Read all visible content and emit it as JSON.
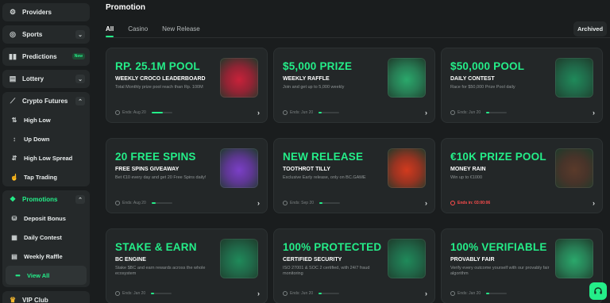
{
  "sidebar": {
    "groups": [
      {
        "items": [
          {
            "label": "Providers",
            "icon": "gear-icon"
          }
        ]
      },
      {
        "items": [
          {
            "label": "Sports",
            "icon": "ball-icon",
            "chevron": "down"
          }
        ]
      },
      {
        "items": [
          {
            "label": "Predictions",
            "icon": "bars-icon",
            "badge": "New"
          }
        ]
      },
      {
        "items": [
          {
            "label": "Lottery",
            "icon": "ticket-icon",
            "chevron": "down"
          }
        ]
      },
      {
        "items": [
          {
            "label": "Crypto Futures",
            "icon": "chart-icon",
            "chevron": "up"
          },
          {
            "label": "High Low",
            "icon": "arrows-icon"
          },
          {
            "label": "Up Down",
            "icon": "arrow-updown-icon"
          },
          {
            "label": "High Low Spread",
            "icon": "spread-icon"
          },
          {
            "label": "Tap Trading",
            "icon": "tap-icon"
          }
        ]
      },
      {
        "items": [
          {
            "label": "Promotions",
            "icon": "gift-icon",
            "chevron": "up",
            "active": true
          },
          {
            "label": "Deposit Bonus",
            "icon": "coins-icon"
          },
          {
            "label": "Daily Contest",
            "icon": "calendar-icon"
          },
          {
            "label": "Weekly Raffle",
            "icon": "ticket-icon"
          },
          {
            "label": "View All",
            "icon": "dots-icon"
          }
        ]
      },
      {
        "items": [
          {
            "label": "VIP Club",
            "icon": "crown-icon"
          }
        ]
      }
    ]
  },
  "header": {
    "title": "Promotion",
    "tabs": [
      "All",
      "Casino",
      "New Release"
    ],
    "archived": "Archived"
  },
  "cards": [
    {
      "title": "RP. 25.1M POOL",
      "subtitle": "WEEKLY CROCO LEADERBOARD",
      "desc": "Total Monthly prize pool reach than Rp. 100M",
      "foot": "Ends: Aug 20",
      "progress": 0.55,
      "art": "slot-machine-art",
      "color": "#c8223a"
    },
    {
      "title": "$5,000 PRIZE",
      "subtitle": "WEEKLY RAFFLE",
      "desc": "Join and get up to 5,000 weekly",
      "foot": "Ends: Jun 20",
      "progress": 0.15,
      "art": "raffle-machine-art",
      "color": "#2aa86b"
    },
    {
      "title": "$50,000 POOL",
      "subtitle": "DAILY CONTEST",
      "desc": "Race for $50,000 Prize Pool daily",
      "foot": "Ends: Jun 20",
      "progress": 0.15,
      "art": "trophy-art",
      "color": "#1f8a5a"
    },
    {
      "title": "20 FREE SPINS",
      "subtitle": "FREE SPINS GIVEAWAY",
      "desc": "Bet €10 every day and get 20 Free Spins daily!",
      "foot": "Ends: Aug 20",
      "progress": 0.2,
      "art": "mascot-art",
      "color": "#7b3fc7"
    },
    {
      "title": "NEW RELEASE",
      "subtitle": "TOOTHROT TILLY",
      "desc": "Exclusive Early release, only on BC.GAME",
      "foot": "Ends: Sep 20",
      "progress": 0.15,
      "art": "tilly-art",
      "color": "#d23a1e"
    },
    {
      "title": "€10K PRIZE POOL",
      "subtitle": "MONEY RAIN",
      "desc": "Win up to €1000",
      "foot": "Ends in: 03:00:06",
      "foot_red": true,
      "progress": null,
      "art": "cowgirl-art",
      "color": "#5a3a2a"
    },
    {
      "title": "STAKE & EARN",
      "subtitle": "BC ENGINE",
      "desc": "Stake $BC and earn rewards across the whole ecosystem",
      "foot": "Ends: Jan 20",
      "progress": 0.15,
      "art": "engine-art",
      "color": "#1f8a5a"
    },
    {
      "title": "100% PROTECTED",
      "subtitle": "CERTIFIED SECURITY",
      "desc": "ISO 27001 & SOC 2 certified, with 24/7 fraud monitoring",
      "foot": "Ends: Jun 20",
      "progress": 0.15,
      "art": "shield-art",
      "color": "#1f8a5a"
    },
    {
      "title": "100% VERIFIABLE",
      "subtitle": "PROVABLY FAIR",
      "desc": "Verify every outcome yourself with our provably fair algorithm",
      "foot": "Ends: Jan 20",
      "progress": 0.15,
      "art": "scale-art",
      "color": "#2aa86b"
    }
  ],
  "chat": {
    "icon": "headset-icon"
  }
}
